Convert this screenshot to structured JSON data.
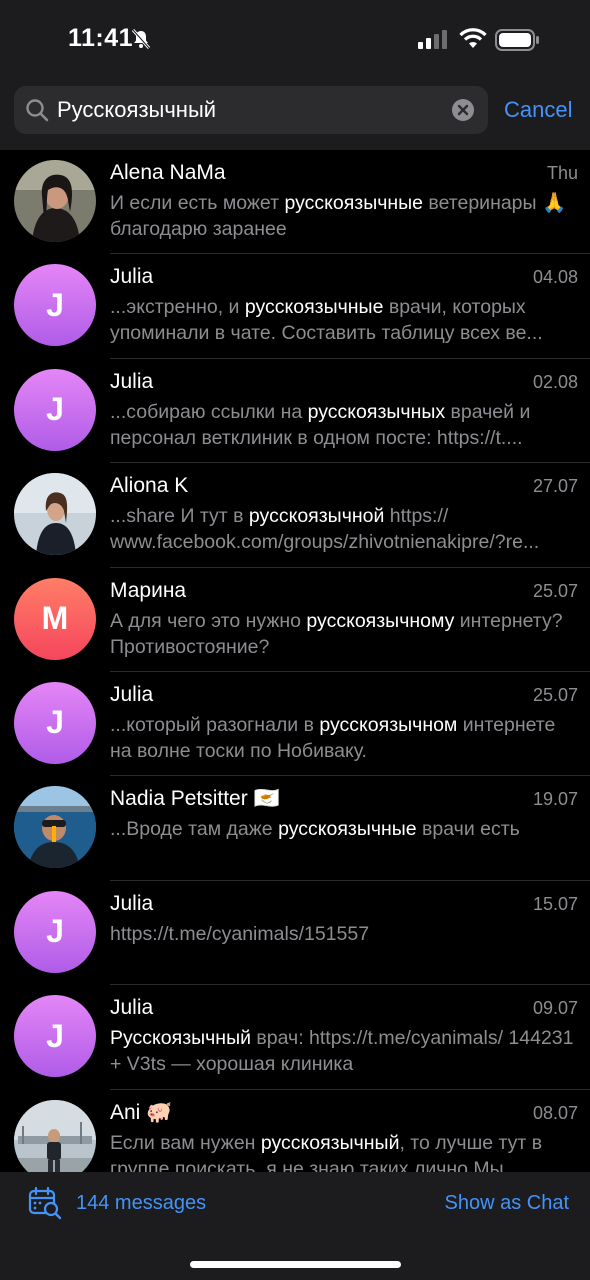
{
  "status_bar": {
    "time": "11:41"
  },
  "search": {
    "query": "Русскоязычный",
    "cancel_label": "Cancel"
  },
  "results": [
    {
      "name": "Alena NaMa",
      "date": "Thu",
      "avatar_type": "photo",
      "preview_parts": [
        {
          "text": "И если есть может ",
          "hl": false
        },
        {
          "text": "русскоязычные",
          "hl": true
        },
        {
          "text": " ветеринары 🙏 благодарю заранее",
          "hl": false
        }
      ]
    },
    {
      "name": "Julia",
      "date": "04.08",
      "avatar_type": "letter",
      "avatar_letter": "J",
      "avatar_color": "violet",
      "preview_parts": [
        {
          "text": "...экстренно, и ",
          "hl": false
        },
        {
          "text": "русскоязычные",
          "hl": true
        },
        {
          "text": " врачи, которых упоминали в чате. Составить таблицу всех ве...",
          "hl": false
        }
      ]
    },
    {
      "name": "Julia",
      "date": "02.08",
      "avatar_type": "letter",
      "avatar_letter": "J",
      "avatar_color": "violet",
      "preview_parts": [
        {
          "text": "...собираю ссылки на ",
          "hl": false
        },
        {
          "text": "русскоязычных",
          "hl": true
        },
        {
          "text": " врачей и персонал ветклиник в одном посте: https://t....",
          "hl": false
        }
      ]
    },
    {
      "name": "Aliona K",
      "date": "27.07",
      "avatar_type": "photo",
      "preview_parts": [
        {
          "text": "...share И тут в ",
          "hl": false
        },
        {
          "text": "русскоязычной",
          "hl": true
        },
        {
          "text": " https:// www.facebook.com/groups/zhivotnienakipre/?re...",
          "hl": false
        }
      ]
    },
    {
      "name": "Марина",
      "date": "25.07",
      "avatar_type": "letter",
      "avatar_letter": "M",
      "avatar_color": "red",
      "preview_parts": [
        {
          "text": "А для чего это нужно ",
          "hl": false
        },
        {
          "text": "русскоязычному",
          "hl": true
        },
        {
          "text": " интернету? Противостояние?",
          "hl": false
        }
      ]
    },
    {
      "name": "Julia",
      "date": "25.07",
      "avatar_type": "letter",
      "avatar_letter": "J",
      "avatar_color": "violet",
      "preview_parts": [
        {
          "text": "...который разогнали в ",
          "hl": false
        },
        {
          "text": "русскоязычном",
          "hl": true
        },
        {
          "text": " интернете на волне тоски по Нобиваку.",
          "hl": false
        }
      ]
    },
    {
      "name": "Nadia Petsitter 🇨🇾",
      "date": "19.07",
      "avatar_type": "photo",
      "preview_parts": [
        {
          "text": "...Вроде там даже ",
          "hl": false
        },
        {
          "text": "русскоязычные",
          "hl": true
        },
        {
          "text": " врачи есть",
          "hl": false
        }
      ]
    },
    {
      "name": "Julia",
      "date": "15.07",
      "avatar_type": "letter",
      "avatar_letter": "J",
      "avatar_color": "violet",
      "preview_parts": [
        {
          "text": "https://t.me/cyanimals/151557",
          "hl": false
        }
      ]
    },
    {
      "name": "Julia",
      "date": "09.07",
      "avatar_type": "letter",
      "avatar_letter": "J",
      "avatar_color": "violet",
      "preview_parts": [
        {
          "text": "Русскоязычный",
          "hl": true
        },
        {
          "text": " врач: https://t.me/cyanimals/ 144231 + V3ts — хорошая клиника",
          "hl": false
        }
      ]
    },
    {
      "name": "Ani 🐖",
      "date": "08.07",
      "avatar_type": "photo",
      "preview_parts": [
        {
          "text": "Если вам нужен ",
          "hl": false
        },
        {
          "text": "русскоязычный",
          "hl": true
        },
        {
          "text": ", то лучше тут в группе поискать, я не знаю таких лично Мы",
          "hl": false
        }
      ]
    }
  ],
  "bottom_bar": {
    "count_label": "144 messages",
    "show_as_chat_label": "Show as Chat"
  },
  "colors": {
    "accent": "#4493f8",
    "background": "#000000",
    "bar": "#1c1c1e",
    "muted_text": "#8d8d92"
  }
}
